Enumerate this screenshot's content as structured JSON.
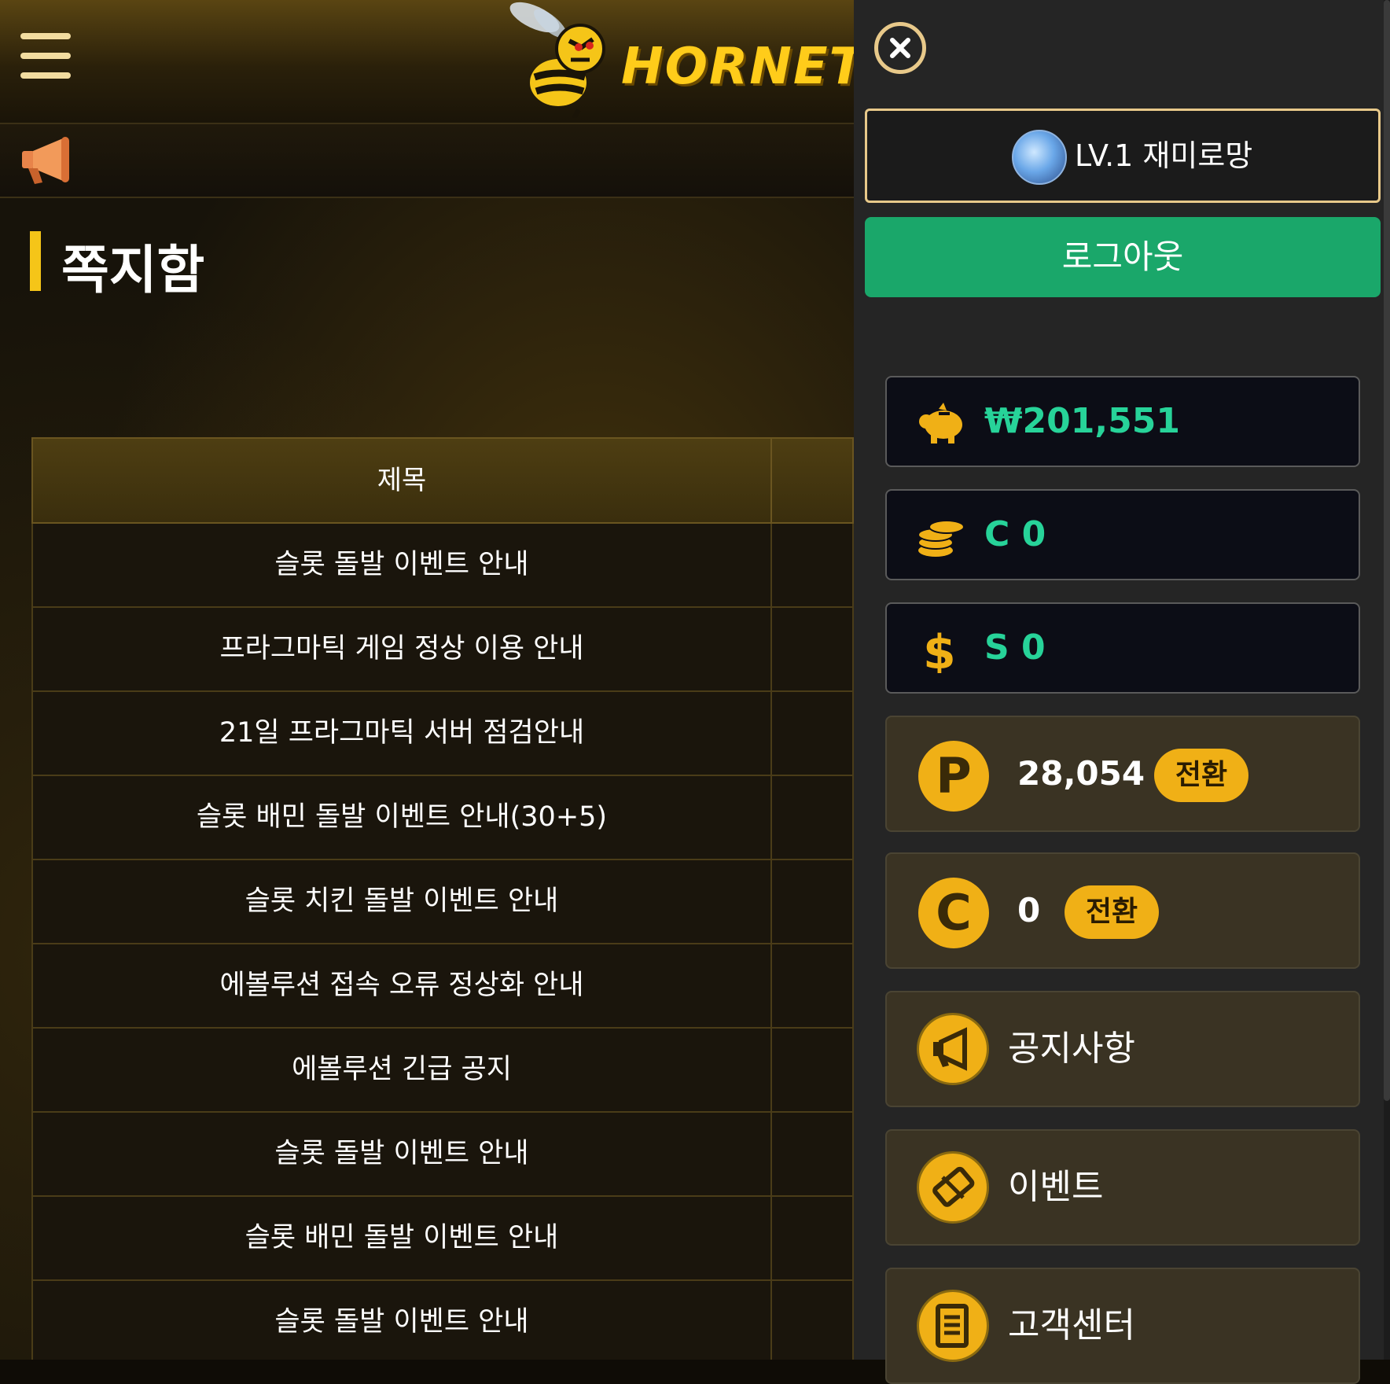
{
  "header": {
    "logo_text": "HORNET"
  },
  "page_title": "쪽지함",
  "table": {
    "header_title": "제목",
    "rows": [
      "슬롯 돌발 이벤트 안내",
      "프라그마틱 게임 정상 이용 안내",
      "21일 프라그마틱 서버 점검안내",
      "슬롯 배민 돌발 이벤트 안내(30+5)",
      "슬롯 치킨 돌발 이벤트 안내",
      "에볼루션 접속 오류 정상화 안내",
      "에볼루션 긴급 공지",
      "슬롯 돌발 이벤트 안내",
      "슬롯 배민 돌발 이벤트 안내",
      "슬롯 돌발 이벤트 안내"
    ]
  },
  "drawer": {
    "user_label": "LV.1 재미로망",
    "logout_label": "로그아웃",
    "balances": {
      "cash": "₩201,551",
      "casino": "C 0",
      "slot": "S 0"
    },
    "points": {
      "value": "28,054",
      "letter": "P",
      "convert_label": "전환"
    },
    "comp": {
      "value": "0",
      "letter": "C",
      "convert_label": "전환"
    },
    "menu": {
      "notice": "공지사항",
      "event": "이벤트",
      "support": "고객센터"
    }
  },
  "colors": {
    "accent_gold": "#f0b016",
    "logout_green": "#1aa76a",
    "balance_green": "#27d399",
    "border_gold": "#e8c98a"
  },
  "icons": {
    "menu": "hamburger-icon",
    "notice_bar": "megaphone-icon",
    "close": "close-icon",
    "cash": "piggy-bank-icon",
    "casino": "coins-stack-icon",
    "slot": "dollar-icon",
    "notice": "megaphone-icon",
    "event": "ticket-icon",
    "support": "receipt-icon"
  }
}
